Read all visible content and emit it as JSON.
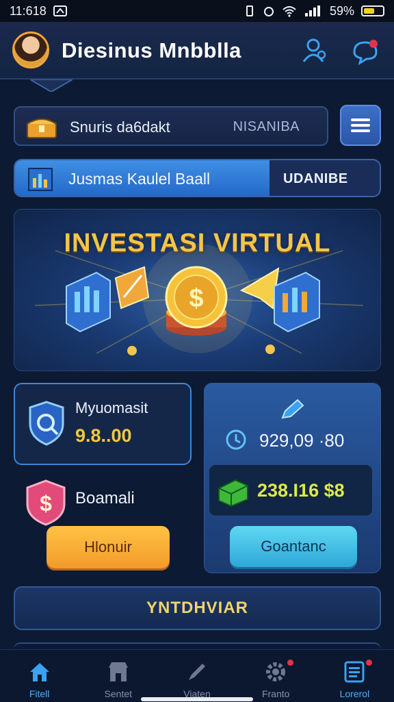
{
  "status_bar": {
    "time": "11:618",
    "battery": "59%",
    "battery_level": 0.59,
    "signal": "ıı"
  },
  "header": {
    "title": "Diesinus Mnbblla",
    "icons": [
      "avatar",
      "friends-icon",
      "chat-icon"
    ]
  },
  "search_row": {
    "label": "Snuris da6dakt",
    "code": "NISANIBA",
    "icon": "treasure-chest-icon"
  },
  "menu_button": {
    "icon": "hamburger-menu-icon"
  },
  "promo_pill": {
    "label": "Jusmas Kaulel Baall",
    "action": "UDANIBE"
  },
  "banner": {
    "title": "INVESTASI VIRTUAL"
  },
  "stats_left": {
    "label": "Myuomasit",
    "value": "9.8..00",
    "icon": "shield-search-icon"
  },
  "promo": {
    "label": "Boamali",
    "icon": "dollar-badge-icon",
    "button": "Hlonuir"
  },
  "stats_right": {
    "amount1": "929,09 ·80",
    "amount2": "238.I16 $8",
    "button": "Goantanc",
    "icons": [
      "pencil-icon",
      "clock-icon",
      "cash-icon"
    ]
  },
  "big_button": {
    "label": "YNTDHVIAR"
  },
  "bottom_nav": [
    {
      "label": "Fitell",
      "icon": "home-icon",
      "active": true
    },
    {
      "label": "Sentet",
      "icon": "shop-icon",
      "active": false
    },
    {
      "label": "Viaten",
      "icon": "pen-icon",
      "active": false
    },
    {
      "label": "Franto",
      "icon": "settings-gear-icon",
      "active": false,
      "badge": true
    },
    {
      "label": "Lorerol",
      "icon": "list-icon",
      "active": false,
      "badge": true
    }
  ],
  "colors": {
    "accent": "#4fb0ff",
    "gold": "#f5c83f",
    "orange": "#f39a2a",
    "cyan": "#2fa7d8",
    "background": "#0d1a33"
  }
}
